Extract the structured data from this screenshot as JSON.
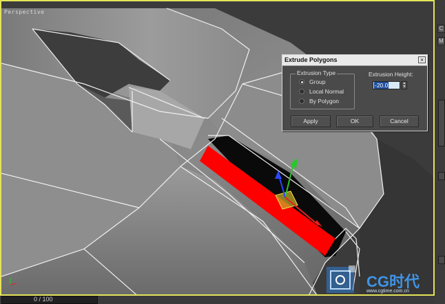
{
  "viewport": {
    "label": "Perspective",
    "active_border_color": "#e4e45a"
  },
  "dialog": {
    "title": "Extrude Polygons",
    "close_glyph": "×",
    "group_label": "Extrusion Type",
    "options": [
      {
        "label": "Group",
        "selected": true
      },
      {
        "label": "Local Normal",
        "selected": false
      },
      {
        "label": "By Polygon",
        "selected": false
      }
    ],
    "height_label": "Extrusion Height:",
    "height_value": "-20.0",
    "buttons": {
      "apply": "Apply",
      "ok": "OK",
      "cancel": "Cancel"
    }
  },
  "right_strip": {
    "top_button": "C",
    "second_button": "M"
  },
  "timeline": {
    "frame": "0 / 100"
  },
  "selection_color": "#ff0000",
  "watermark": {
    "text": "CG时代",
    "url": "www.cgtime.com.cn"
  }
}
